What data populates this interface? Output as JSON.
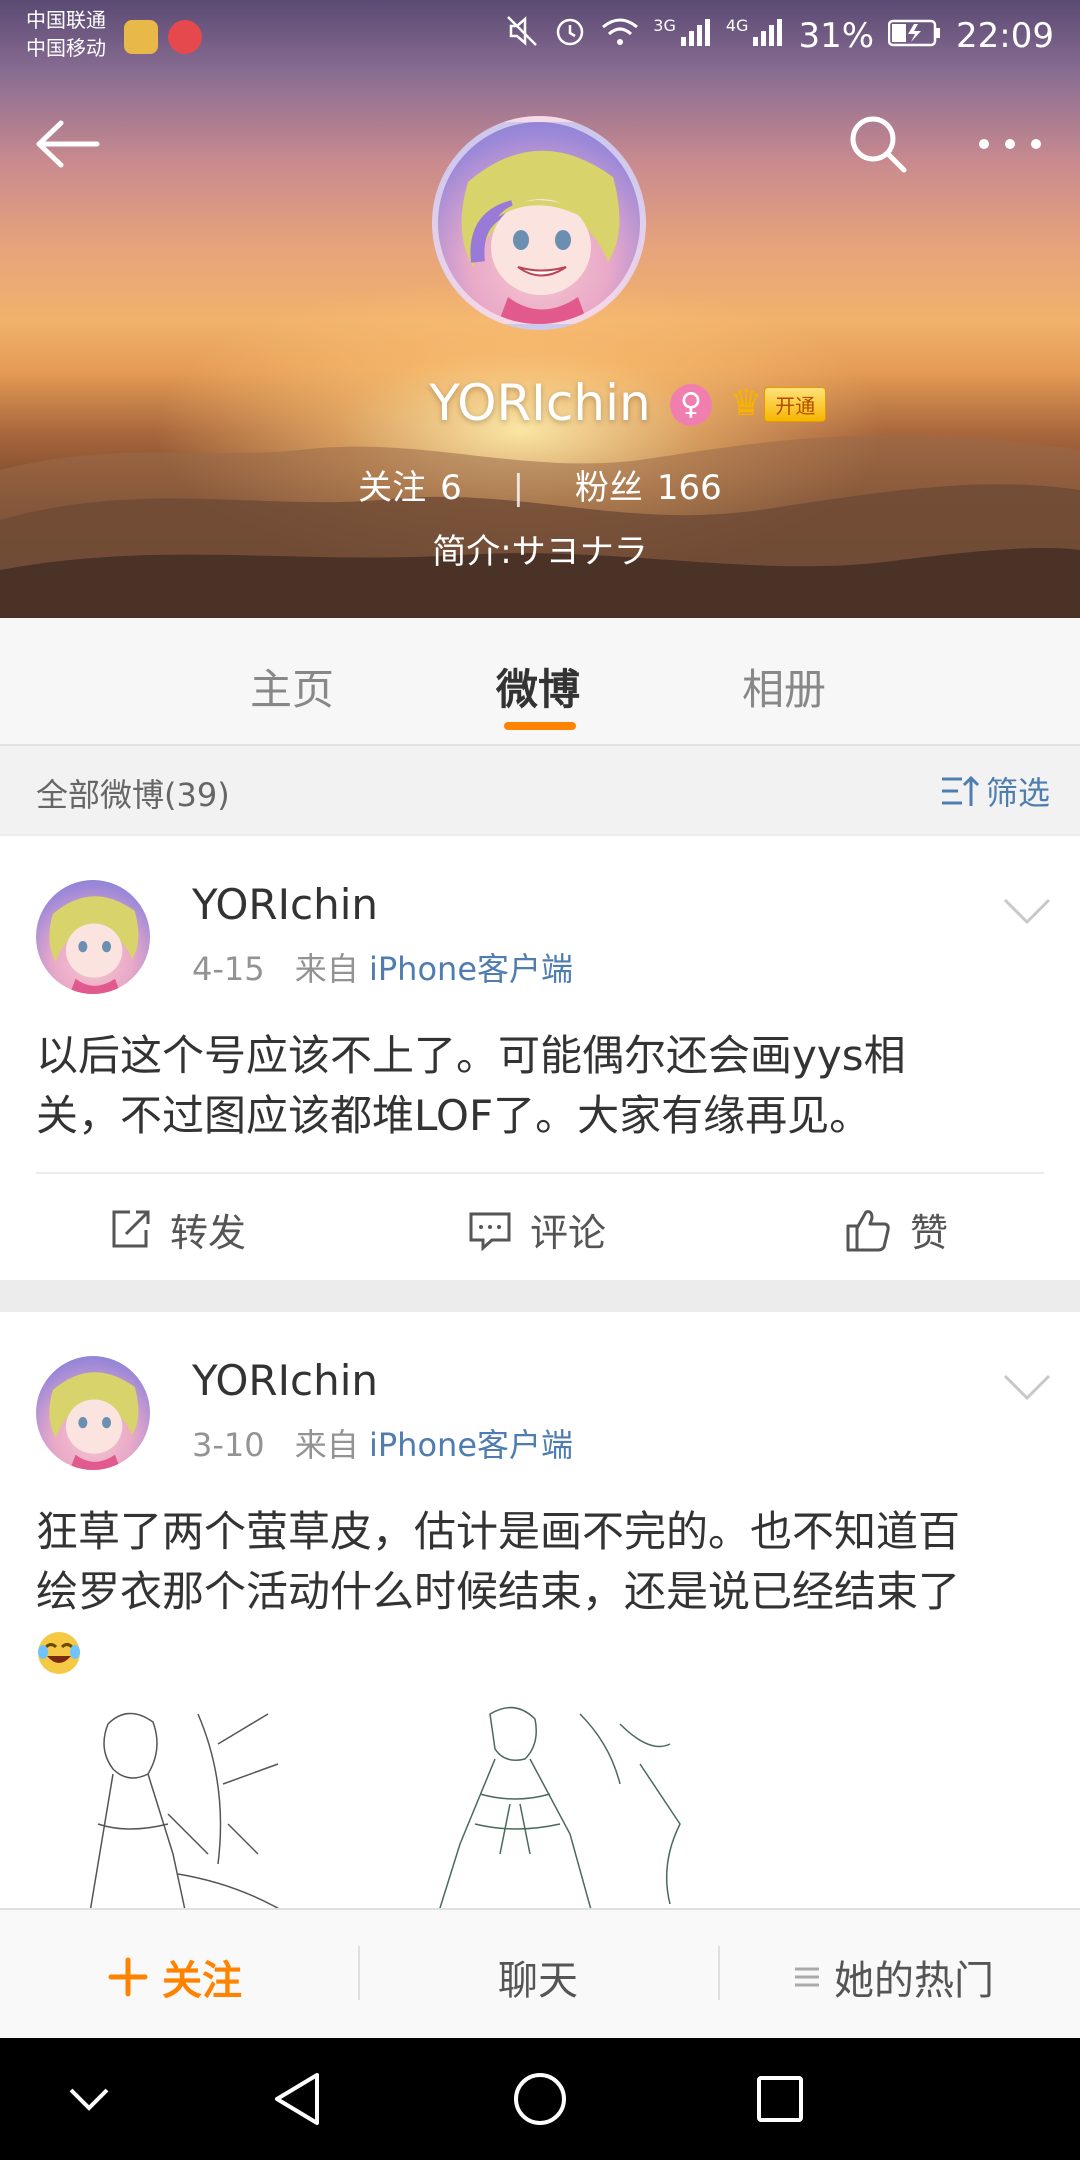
{
  "status_bar": {
    "carrier_1": "中国联通",
    "carrier_2": "中国移动",
    "network_1": "3G",
    "network_2": "4G",
    "battery_pct": "31%",
    "time": "22:09"
  },
  "profile": {
    "username": "YORIchin",
    "vip_label": "开通",
    "following_label": "关注",
    "following_count": "6",
    "separator": "|",
    "followers_label": "粉丝",
    "followers_count": "166",
    "bio": "简介:サヨナラ"
  },
  "tabs": [
    {
      "label": "主页"
    },
    {
      "label": "微博"
    },
    {
      "label": "相册"
    }
  ],
  "filter_bar": {
    "title": "全部微博(39)",
    "filter_label": "筛选"
  },
  "posts": [
    {
      "author": "YORIchin",
      "date": "4-15",
      "source_prefix": "来自",
      "source": "iPhone客户端",
      "text_line_1": "以后这个号应该不上了。可能偶尔还会画yys相",
      "text_line_2": "关，不过图应该都堆LOF了。大家有缘再见。",
      "actions": {
        "repost": "转发",
        "comment": "评论",
        "like": "赞"
      }
    },
    {
      "author": "YORIchin",
      "date": "3-10",
      "source_prefix": "来自",
      "source": "iPhone客户端",
      "text_line_1": "狂草了两个萤草皮，估计是画不完的。也不知道百",
      "text_line_2": "绘罗衣那个活动什么时候结束，还是说已经结束了",
      "emoji": "laughing-crying-emoji"
    }
  ],
  "bottom_bar": {
    "follow_label": "关注",
    "chat_label": "聊天",
    "hot_label": "她的热门"
  },
  "colors": {
    "accent_orange": "#ff8200",
    "link_blue": "#507daf",
    "female_pink": "#f07fb0"
  }
}
